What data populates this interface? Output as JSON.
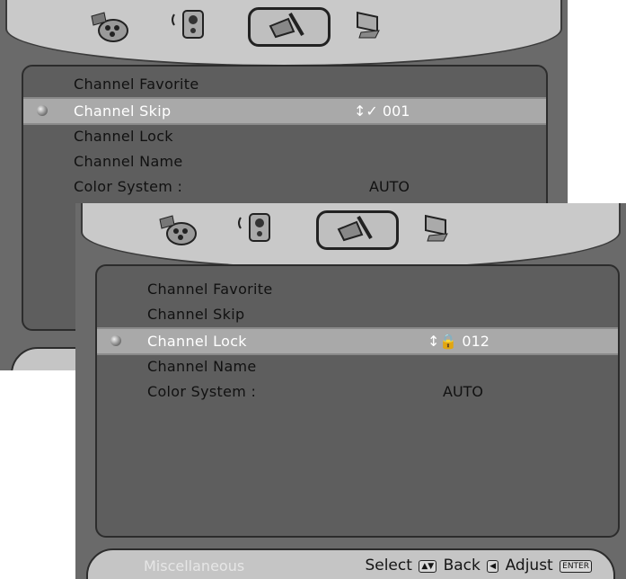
{
  "menu_items": [
    "Channel Favorite",
    "Channel Skip",
    "Channel Lock",
    "Channel Name",
    "Color System :"
  ],
  "back_screen": {
    "selected_item": "Channel Skip",
    "selected_value": "↕✓ 001",
    "color_system_value": "AUTO"
  },
  "front_screen": {
    "selected_item": "Channel Lock",
    "selected_value": "↕🔒 012",
    "color_system_value": "AUTO"
  },
  "footer": {
    "title": "Miscellaneous",
    "select_label": "Select",
    "select_key": "▲▼",
    "back_label": "Back",
    "back_key": "◀",
    "adjust_label": "Adjust",
    "adjust_key": "ENTER"
  },
  "tabs": [
    "movie-reel-icon",
    "speaker-icon",
    "tools-icon",
    "computer-icon"
  ],
  "colors": {
    "highlight": "#a9a9a9",
    "panel": "#5e5e5e",
    "frame": "#c9c9c9"
  }
}
